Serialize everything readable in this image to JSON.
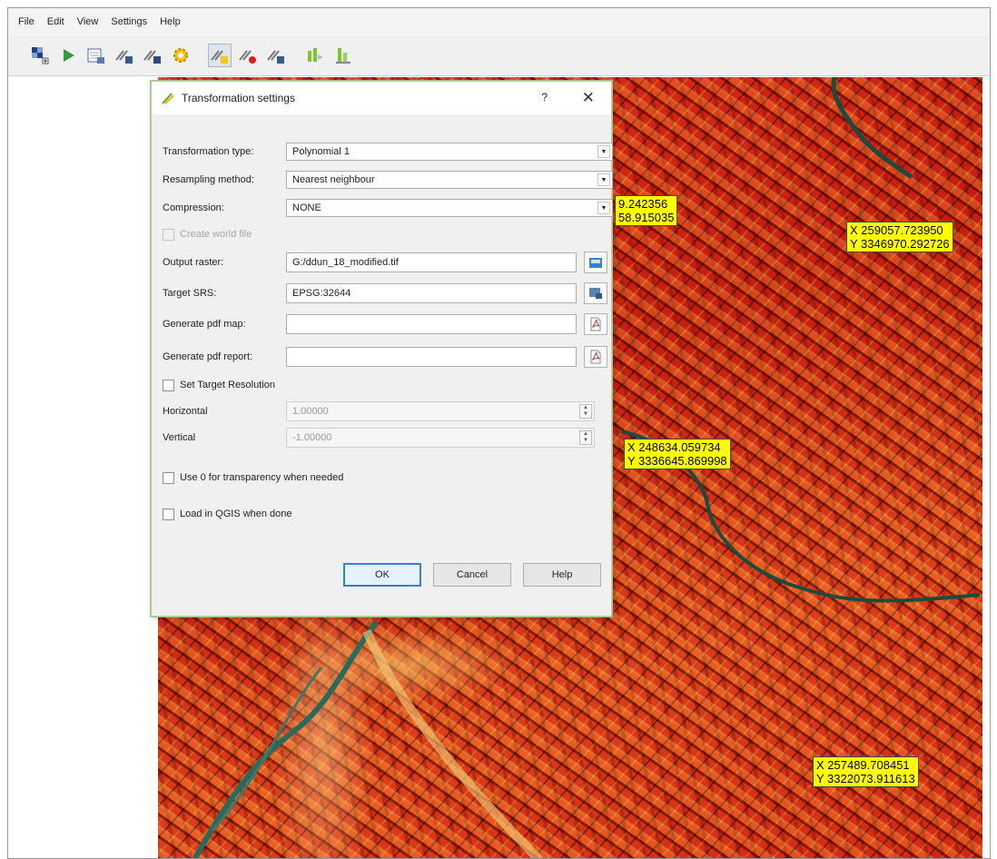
{
  "menu": [
    "File",
    "Edit",
    "View",
    "Settings",
    "Help"
  ],
  "toolbar": [
    {
      "icon": "open-raster-icon"
    },
    {
      "icon": "start-georeferencing-icon"
    },
    {
      "icon": "generate-gdal-script-icon"
    },
    {
      "icon": "load-gcp-points-icon"
    },
    {
      "icon": "save-gcp-points-icon"
    },
    {
      "icon": "transformation-settings-icon"
    },
    {
      "icon": "add-point-icon"
    },
    {
      "icon": "delete-point-icon"
    },
    {
      "icon": "move-gcp-point-icon"
    },
    {
      "icon": "pan-icon"
    },
    {
      "icon": "zoom-to-layer-icon"
    }
  ],
  "dialog": {
    "title": "Transformation settings",
    "help_glyph": "?",
    "close_glyph": "✕",
    "transformation_type_label": "Transformation type:",
    "transformation_type_value": "Polynomial 1",
    "resampling_label": "Resampling method:",
    "resampling_value": "Nearest neighbour",
    "compression_label": "Compression:",
    "compression_value": "NONE",
    "create_world_file_label": "Create world file",
    "output_raster_label": "Output raster:",
    "output_raster_value": "G:/ddun_18_modified.tif",
    "target_srs_label": "Target SRS:",
    "target_srs_value": "EPSG:32644",
    "pdf_map_label": "Generate pdf map:",
    "pdf_map_value": "",
    "pdf_report_label": "Generate pdf report:",
    "pdf_report_value": "",
    "set_target_resolution_label": "Set Target Resolution",
    "horizontal_label": "Horizontal",
    "horizontal_value": "1.00000",
    "vertical_label": "Vertical",
    "vertical_value": "-1.00000",
    "use_zero_transparency_label": "Use 0 for transparency when needed",
    "load_in_qgis_label": "Load in QGIS when done",
    "ok_label": "OK",
    "cancel_label": "Cancel",
    "help_label": "Help"
  },
  "map_labels": [
    {
      "x": "9.242356",
      "y": "58.915035"
    },
    {
      "x": "X 259057.723950",
      "y": "Y 3346970.292726"
    },
    {
      "x": "X 248634.059734",
      "y": "Y 3336645.869998"
    },
    {
      "x": "X 257489.708451",
      "y": "Y 3322073.911613"
    }
  ]
}
